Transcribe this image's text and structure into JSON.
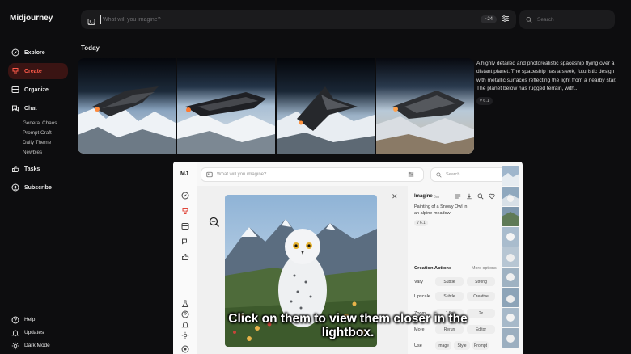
{
  "app": {
    "title": "Midjourney"
  },
  "sidebar": {
    "items": [
      {
        "label": "Explore",
        "icon": "compass-icon"
      },
      {
        "label": "Create",
        "icon": "brush-icon",
        "active": true
      },
      {
        "label": "Organize",
        "icon": "folder-icon"
      },
      {
        "label": "Chat",
        "icon": "chat-icon"
      },
      {
        "label": "Tasks",
        "icon": "thumbs-up-icon"
      },
      {
        "label": "Subscribe",
        "icon": "user-icon"
      }
    ],
    "chat_channels": [
      "General Chaos",
      "Prompt Craft",
      "Daily Theme",
      "Newbies"
    ],
    "bottom": [
      {
        "label": "Help",
        "icon": "help-icon"
      },
      {
        "label": "Updates",
        "icon": "bell-icon"
      },
      {
        "label": "Dark Mode",
        "icon": "moon-icon"
      }
    ]
  },
  "topbar": {
    "placeholder": "What will you imagine?",
    "count_badge": "~24"
  },
  "search": {
    "placeholder": "Search"
  },
  "feed": {
    "section_title": "Today",
    "description": "A highly detailed and photorealistic spaceship flying over a distant planet. The spaceship has a sleek, futuristic design with metallic surfaces reflecting the light from a nearby star. The planet below has rugged terrain, with...",
    "version_badge": "v 6.1"
  },
  "embedded": {
    "logo": "MJ",
    "prompt_placeholder": "What will you imagine?",
    "search_placeholder": "Search",
    "panel": {
      "title": "Imagine",
      "time": "5m",
      "prompt": "Painting of a Snowy Owl in an alpine meadow",
      "version": "v 6.1",
      "section": "Creation Actions",
      "more": "More options",
      "rows": [
        {
          "label": "Vary",
          "buttons": [
            "Subtle",
            "Strong"
          ]
        },
        {
          "label": "Upscale",
          "buttons": [
            "Subtle",
            "Creative"
          ]
        },
        {
          "label": "Zoom",
          "buttons": [
            "1.5x",
            "2x"
          ]
        },
        {
          "label": "More",
          "buttons": [
            "Rerun",
            "Editor"
          ]
        },
        {
          "label": "Use",
          "buttons": [
            "Image",
            "Style",
            "Prompt"
          ]
        }
      ]
    }
  },
  "caption": "Click on them to view them closer in the lightbox."
}
